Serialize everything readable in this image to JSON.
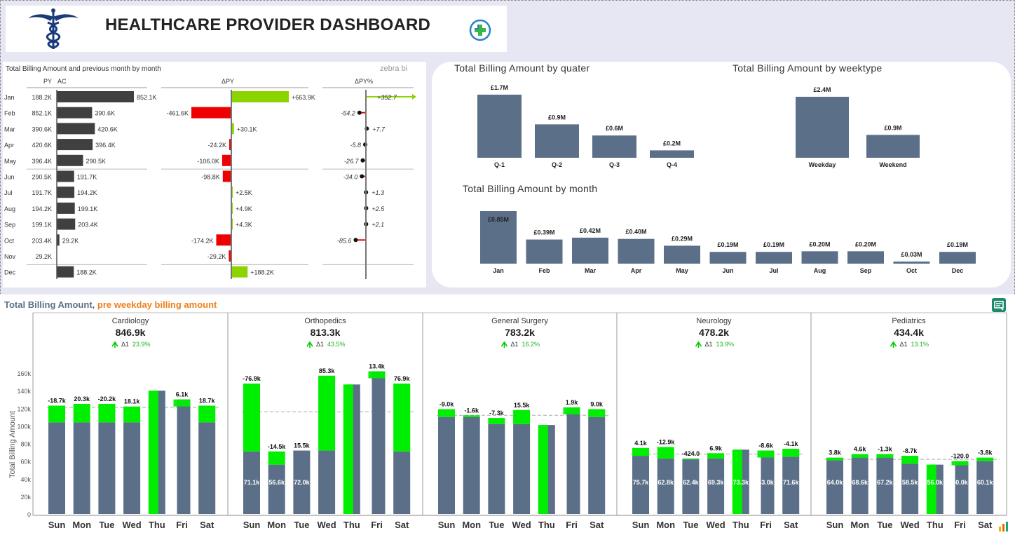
{
  "header": {
    "title": "HEALTHCARE PROVIDER DASHBOARD",
    "logo_icon": "caduceus-icon",
    "badge_icon": "medical-cross-icon"
  },
  "variance": {
    "subtitle": "Total Billing Amount and previous month by month",
    "zebra": "zebra bi",
    "col_py": "PY",
    "col_ac": "AC",
    "col_dpy": "ΔPY",
    "col_dpyp": "ΔPY%",
    "colors": {
      "ac": "#404040",
      "pos": "#8cd400",
      "neg": "#ee0000"
    }
  },
  "chart_data": [
    {
      "type": "bar",
      "title": "Total Billing Amount and previous month by month",
      "categories": [
        "Jan",
        "Feb",
        "Mar",
        "Apr",
        "May",
        "Jun",
        "Jul",
        "Aug",
        "Sep",
        "Oct",
        "Nov",
        "Dec"
      ],
      "py_labels": [
        "188.2K",
        "852.1K",
        "390.6K",
        "420.6K",
        "396.4K",
        "290.5K",
        "191.7K",
        "194.2K",
        "199.1K",
        "203.4K",
        "29.2K",
        ""
      ],
      "ac": [
        852.1,
        390.6,
        420.6,
        396.4,
        290.5,
        191.7,
        194.2,
        199.1,
        203.4,
        29.2,
        null,
        188.2
      ],
      "ac_labels": [
        "852.1K",
        "390.6K",
        "420.6K",
        "396.4K",
        "290.5K",
        "191.7K",
        "194.2K",
        "199.1K",
        "203.4K",
        "29.2K",
        "",
        "188.2K"
      ],
      "dpy": [
        663.9,
        -461.6,
        30.1,
        -24.2,
        -106.0,
        -98.8,
        2.5,
        4.9,
        4.3,
        -174.2,
        -29.2,
        188.2
      ],
      "dpy_labels": [
        "+663.9K",
        "-461.6K",
        "+30.1K",
        "-24.2K",
        "-106.0K",
        "-98.8K",
        "+2.5K",
        "+4.9K",
        "+4.3K",
        "-174.2K",
        "-29.2K",
        "+188.2K"
      ],
      "dpyp": [
        352.7,
        -54.2,
        7.7,
        -5.8,
        -26.7,
        -34.0,
        1.3,
        2.5,
        2.1,
        -85.6,
        null,
        null
      ],
      "dpyp_labels": [
        "+352.7",
        "-54.2",
        "+7.7",
        "-5.8",
        "-26.7",
        "-34.0",
        "+1.3",
        "+2.5",
        "+2.1",
        "-85.6",
        "",
        ""
      ]
    },
    {
      "type": "bar",
      "title": "Total Billing Amount by quater",
      "categories": [
        "Q-1",
        "Q-2",
        "Q-3",
        "Q-4"
      ],
      "values": [
        1.7,
        0.9,
        0.6,
        0.2
      ],
      "labels": [
        "£1.7M",
        "£0.9M",
        "£0.6M",
        "£0.2M"
      ]
    },
    {
      "type": "bar",
      "title": "Total Billing Amount by weektype",
      "categories": [
        "Weekday",
        "Weekend"
      ],
      "values": [
        2.4,
        0.9
      ],
      "labels": [
        "£2.4M",
        "£0.9M"
      ]
    },
    {
      "type": "bar",
      "title": "Total Billing Amount by month",
      "categories": [
        "Jan",
        "Feb",
        "Mar",
        "Apr",
        "May",
        "Jun",
        "Jul",
        "Aug",
        "Sep",
        "Oct",
        "Dec"
      ],
      "values": [
        0.85,
        0.39,
        0.42,
        0.4,
        0.29,
        0.19,
        0.19,
        0.2,
        0.2,
        0.03,
        0.19
      ],
      "labels": [
        "£0.85M",
        "£0.39M",
        "£0.42M",
        "£0.40M",
        "£0.29M",
        "£0.19M",
        "£0.19M",
        "£0.20M",
        "£0.20M",
        "£0.03M",
        "£0.19M"
      ]
    },
    {
      "type": "bar",
      "title": "Total Billing Amount, pre weekday billing amount",
      "ylabel": "Total Billing Amount",
      "ylim": [
        0,
        170
      ],
      "yticks": [
        "0",
        "20k",
        "40k",
        "60k",
        "80k",
        "100k",
        "120k",
        "140k",
        "160k"
      ],
      "categories": [
        "Sun",
        "Mon",
        "Tue",
        "Wed",
        "Thu",
        "Fri",
        "Sat"
      ],
      "panels": [
        {
          "name": "Cardiology",
          "total": "846.9k",
          "delta_label": "Δ1",
          "delta_pct": "23.9%",
          "avg": 121,
          "base": [
            104,
            104,
            104,
            104,
            0,
            0,
            104
          ],
          "top": [
            123,
            125,
            125,
            122,
            140,
            130,
            123
          ],
          "labels": [
            "-18.7k",
            "20.3k",
            "-20.2k",
            "18.1k",
            "",
            "6.1k",
            "18.7k"
          ],
          "inside": [
            "",
            "",
            "",
            "",
            "",
            "",
            ""
          ]
        },
        {
          "name": "Orthopedics",
          "total": "813.3k",
          "delta_label": "Δ1",
          "delta_pct": "43.5%",
          "avg": 116,
          "base": [
            71,
            56,
            72,
            72,
            0,
            0,
            71
          ],
          "top": [
            148,
            71,
            72,
            157,
            147,
            162,
            148
          ],
          "labels": [
            "-76.9k",
            "-14.5k",
            "15.5k",
            "85.3k",
            "",
            "13.4k",
            "76.9k"
          ],
          "inside": [
            "71.1k",
            "56.6k",
            "72.0k",
            "",
            "",
            "",
            ""
          ]
        },
        {
          "name": "General Surgery",
          "total": "783.2k",
          "delta_label": "Δ1",
          "delta_pct": "16.2%",
          "avg": 112,
          "base": [
            110,
            110,
            102,
            102,
            0,
            0,
            110
          ],
          "top": [
            119,
            112,
            109,
            118,
            101,
            121,
            119
          ],
          "labels": [
            "-9.0k",
            "-1.6k",
            "-7.3k",
            "15.5k",
            "",
            "1.9k",
            "9.0k"
          ],
          "inside": [
            "",
            "",
            "",
            "",
            "",
            "",
            ""
          ]
        },
        {
          "name": "Neurology",
          "total": "478.2k",
          "delta_label": "Δ1",
          "delta_pct": "13.9%",
          "avg": 68,
          "base": [
            66,
            63,
            62,
            63,
            0,
            0,
            65
          ],
          "top": [
            75,
            76,
            63,
            69,
            73,
            72,
            74
          ],
          "labels": [
            "4.1k",
            "-12.9k",
            "-424.0",
            "6.9k",
            "",
            "-8.6k",
            "-4.1k"
          ],
          "inside": [
            "75.7k",
            "62.8k",
            "62.4k",
            "69.3k",
            "73.3k",
            "63.0k",
            "71.6k"
          ]
        },
        {
          "name": "Pediatrics",
          "total": "434.4k",
          "delta_label": "Δ1",
          "delta_pct": "13.1%",
          "avg": 62,
          "base": [
            61,
            64,
            64,
            57,
            0,
            0,
            60
          ],
          "top": [
            64,
            68,
            68,
            66,
            56,
            60,
            64
          ],
          "labels": [
            "3.8k",
            "4.6k",
            "-1.3k",
            "-8.7k",
            "",
            "-120.0",
            "-3.8k"
          ],
          "inside": [
            "64.0k",
            "68.6k",
            "67.2k",
            "58.5k",
            "56.0k",
            "60.0k",
            "60.1k"
          ]
        }
      ]
    }
  ],
  "panel2": {
    "quarter_title": "Total Billing Amount by quater",
    "weektype_title": "Total Billing Amount by weektype",
    "month_title": "Total Billing Amount by month",
    "bar_color": "#5b7088"
  },
  "panel3": {
    "title_a": "Total Billing Amount",
    "title_sep": ", ",
    "title_b": "pre weekday billing amount",
    "colors": {
      "base": "#5b7088",
      "pos": "#00ee00",
      "neg": "#ee0000",
      "delta_arrow": "#00cc00"
    },
    "focus_icon": "focus-mode-icon",
    "chart_icon": "bar-chart-icon"
  }
}
